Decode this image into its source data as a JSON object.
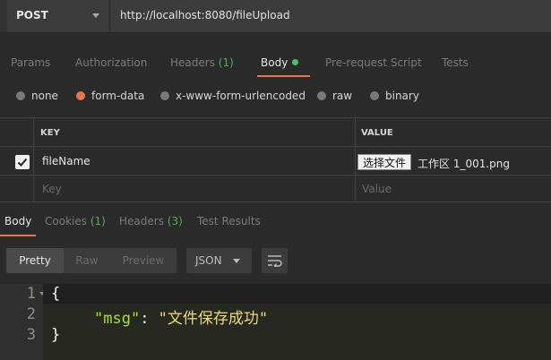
{
  "request": {
    "method": "POST",
    "url": "http://localhost:8080/fileUpload"
  },
  "request_tabs": [
    {
      "label": "Params"
    },
    {
      "label": "Authorization"
    },
    {
      "label": "Headers",
      "count": "(1)"
    },
    {
      "label": "Body"
    },
    {
      "label": "Pre-request Script"
    },
    {
      "label": "Tests"
    }
  ],
  "body_types": {
    "options": [
      "none",
      "form-data",
      "x-www-form-urlencoded",
      "raw",
      "binary"
    ],
    "selected": "form-data"
  },
  "kv_table": {
    "headers": {
      "key": "KEY",
      "value": "VALUE"
    },
    "rows": [
      {
        "checked": true,
        "key": "fileName",
        "file_button": "选择文件",
        "file_name": "工作区 1_001.png"
      }
    ],
    "placeholder": {
      "key": "Key",
      "value": "Value"
    }
  },
  "response_tabs": [
    {
      "label": "Body"
    },
    {
      "label": "Cookies",
      "count": "(1)"
    },
    {
      "label": "Headers",
      "count": "(3)"
    },
    {
      "label": "Test Results"
    }
  ],
  "response_view": {
    "modes": [
      "Pretty",
      "Raw",
      "Preview"
    ],
    "active_mode": "Pretty",
    "format": "JSON"
  },
  "code": {
    "line_numbers": [
      "1",
      "2",
      "3"
    ],
    "open_brace": "{",
    "key": "\"msg\"",
    "colon": ": ",
    "value": "\"文件保存成功\"",
    "close_brace": "}"
  },
  "colors": {
    "accent": "#e8744b",
    "count_green": "#5aa65a",
    "json_key": "#a6e22e",
    "json_string": "#e6db74"
  },
  "icons": [
    "chevron-down-icon",
    "checkmark-icon",
    "wrap-lines-icon",
    "fold-arrow-icon"
  ]
}
